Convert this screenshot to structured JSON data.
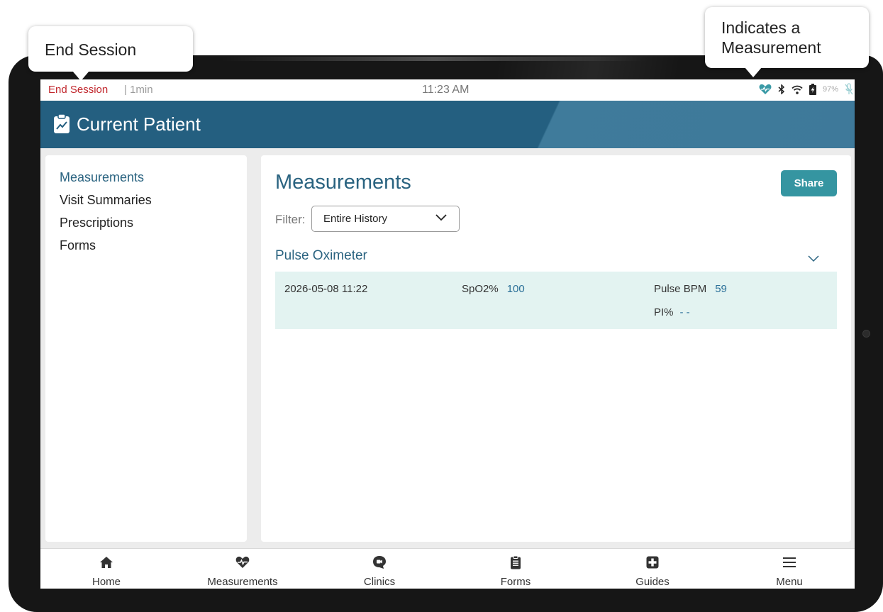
{
  "callouts": {
    "end_session": "End Session",
    "indicator_line1": "Indicates a",
    "indicator_line2": "Measurement"
  },
  "statusbar": {
    "end_session": "End Session",
    "session_time": "| 1min",
    "clock": "11:23 AM",
    "battery": "97%",
    "icons": [
      "heart-measurement-icon",
      "bluetooth-icon",
      "wifi-icon",
      "battery-charging-icon",
      "mic-off-icon"
    ]
  },
  "header": {
    "title": "Current Patient",
    "icon": "clipboard-chart-icon"
  },
  "sidebar": {
    "items": [
      {
        "label": "Measurements",
        "active": true
      },
      {
        "label": "Visit Summaries",
        "active": false
      },
      {
        "label": "Prescriptions",
        "active": false
      },
      {
        "label": "Forms",
        "active": false
      }
    ]
  },
  "main": {
    "title": "Measurements",
    "share_label": "Share",
    "filter_label": "Filter:",
    "filter_value": "Entire History",
    "section_title": "Pulse Oximeter",
    "reading": {
      "datetime": "2026-05-08 11:22",
      "spo2_label": "SpO2%",
      "spo2_value": "100",
      "pulse_label": "Pulse BPM",
      "pulse_value": "59",
      "pi_label": "PI%",
      "pi_value": "- -"
    }
  },
  "nav": {
    "items": [
      {
        "label": "Home",
        "icon": "home-icon"
      },
      {
        "label": "Measurements",
        "icon": "heart-pulse-icon"
      },
      {
        "label": "Clinics",
        "icon": "video-chat-icon"
      },
      {
        "label": "Forms",
        "icon": "clipboard-icon"
      },
      {
        "label": "Guides",
        "icon": "first-aid-icon"
      },
      {
        "label": "Menu",
        "icon": "hamburger-menu-icon"
      }
    ]
  },
  "colors": {
    "header": "#245f80",
    "accent_text": "#2a6380",
    "share_button": "#3595a1",
    "end_session": "#c1272d",
    "reading_row": "#e3f3f1",
    "heart_indicator": "#3a9aa6"
  }
}
